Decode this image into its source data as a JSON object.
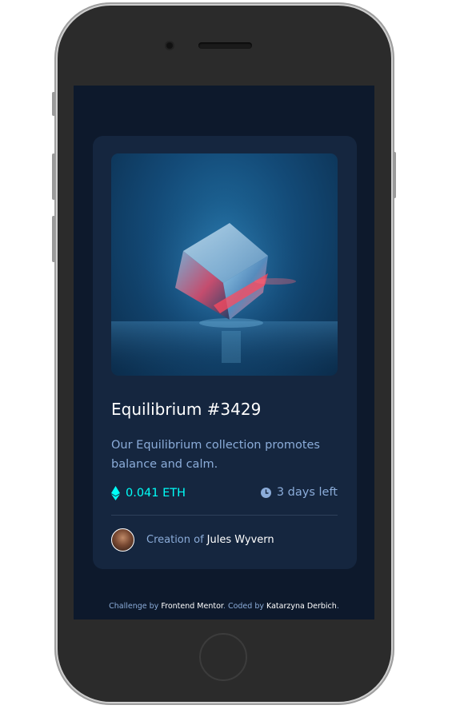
{
  "card": {
    "title": "Equilibrium #3429",
    "description": "Our Equilibrium collection promotes balance and calm.",
    "price": "0.041 ETH",
    "time_left": "3 days left",
    "creator_prefix": "Creation of",
    "creator_name": "Jules Wyvern"
  },
  "attribution": {
    "challenge_by": "Challenge by",
    "frontend_mentor": "Frontend Mentor",
    "coded_by": ". Coded by",
    "author": "Katarzyna Derbich",
    "end": "."
  },
  "colors": {
    "background": "#0d192c",
    "card": "#15263f",
    "cyan": "#00fff8",
    "soft_blue": "#8bacd9",
    "white": "#ffffff"
  },
  "icons": {
    "price": "ethereum-icon",
    "time": "clock-icon"
  }
}
